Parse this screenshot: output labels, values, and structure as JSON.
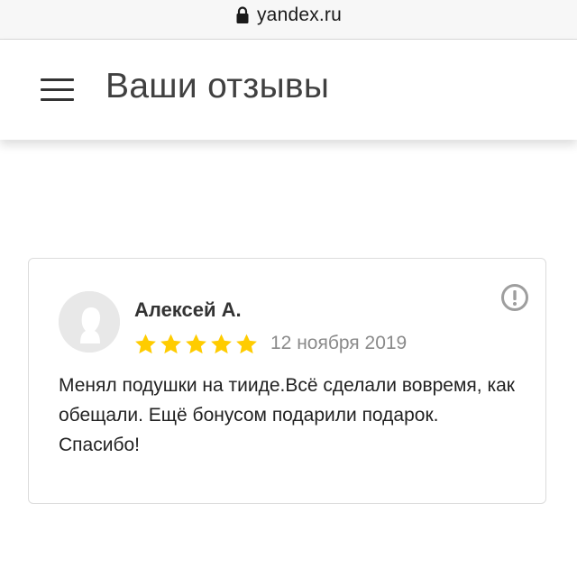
{
  "browser": {
    "url": "yandex.ru",
    "icons": {
      "lock": "lock-icon"
    }
  },
  "header": {
    "title": "Ваши отзывы",
    "icons": {
      "menu": "hamburger-menu-icon"
    }
  },
  "review": {
    "author": "Алексей А.",
    "rating": 5,
    "rating_max": 5,
    "date": "12 ноября 2019",
    "text": "Менял подушки на тииде.Всё сделали вовремя, как обещали. Ещё бонусом подарили подарок. Спасибо!",
    "icons": {
      "avatar": "user-avatar-placeholder",
      "report": "report-exclamation-icon",
      "star": "star-icon"
    },
    "colors": {
      "star": "#ffcc00",
      "report": "#9e9e9e"
    }
  }
}
